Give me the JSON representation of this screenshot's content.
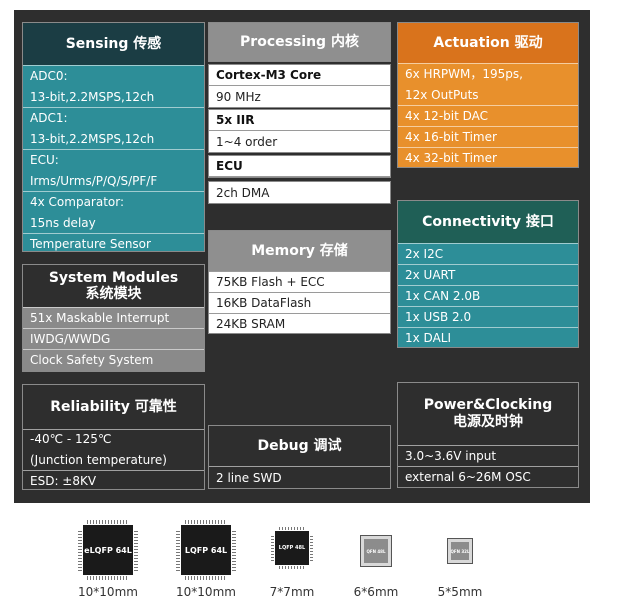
{
  "sensing": {
    "title": "Sensing",
    "title_cn": "传感",
    "items": [
      [
        "ADC0:",
        "13-bit,2.2MSPS,12ch"
      ],
      [
        "ADC1:",
        "13-bit,2.2MSPS,12ch"
      ],
      [
        "ECU:",
        "Irms/Urms/P/Q/S/PF/F"
      ],
      [
        "4x Comparator:",
        "15ns delay"
      ],
      [
        "Temperature Sensor"
      ]
    ]
  },
  "processing": {
    "title": "Processing",
    "title_cn": "内核",
    "core_label": "Cortex-M3 Core",
    "core_value": "90 MHz",
    "iir_label": "5x IIR",
    "iir_value": "1~4 order",
    "ecu_label": "ECU",
    "ecu_value": "2ch DMA"
  },
  "actuation": {
    "title": "Actuation",
    "title_cn": "驱动",
    "items": [
      [
        "6x HRPWM，195ps,",
        "12x OutPuts"
      ],
      [
        "4x 12-bit DAC"
      ],
      [
        "4x 16-bit Timer"
      ],
      [
        "4x 32-bit Timer"
      ]
    ]
  },
  "connectivity": {
    "title": "Connectivity",
    "title_cn": "接口",
    "items": [
      "2x I2C",
      "2x UART",
      "1x CAN 2.0B",
      "1x USB 2.0",
      "1x DALI"
    ]
  },
  "memory": {
    "title": "Memory",
    "title_cn": "存储",
    "items": [
      "75KB Flash + ECC",
      "16KB DataFlash",
      "24KB SRAM"
    ]
  },
  "system_modules": {
    "title": "System Modules",
    "title_cn": "系统模块",
    "items": [
      "51x Maskable Interrupt",
      "IWDG/WWDG",
      "Clock Safety System"
    ]
  },
  "reliability": {
    "title": "Reliability",
    "title_cn": "可靠性",
    "items": [
      [
        "-40℃ - 125℃",
        "(Junction temperature)"
      ],
      [
        "ESD: ±8KV"
      ]
    ]
  },
  "debug": {
    "title": "Debug",
    "title_cn": "调试",
    "items": [
      "2 line SWD"
    ]
  },
  "power": {
    "title": "Power&Clocking",
    "title_cn": "电源及时钟",
    "items": [
      "3.0~3.6V input",
      "external 6~26M OSC"
    ]
  },
  "packages": [
    {
      "label": "eLQFP 64L",
      "size": "10*10mm"
    },
    {
      "label": "LQFP 64L",
      "size": "10*10mm"
    },
    {
      "label": "LQFP 48L",
      "size": "7*7mm"
    },
    {
      "label": "QFN 48L",
      "size": "6*6mm"
    },
    {
      "label": "QFN 32L",
      "size": "5*5mm"
    }
  ],
  "colors": {
    "background": "#2e2e2e",
    "teal": "#2d8e98",
    "teal_header": "#1b3d44",
    "orange": "#e8902c",
    "orange_header": "#d9731c",
    "gray": "#8f8f8f"
  }
}
